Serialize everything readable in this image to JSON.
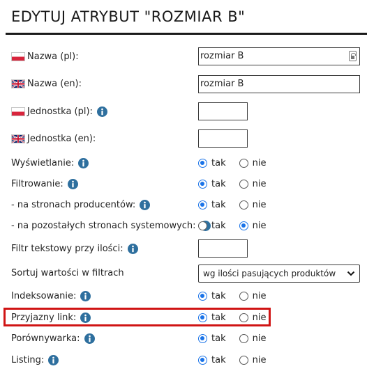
{
  "dialog": {
    "title": "EDYTUJ ATRYBUT \"ROZMIAR B\""
  },
  "fields": {
    "name_pl": {
      "label": "Nazwa (pl):",
      "value": "rozmiar B"
    },
    "name_en": {
      "label": "Nazwa (en):",
      "value": "rozmiar B"
    },
    "unit_pl": {
      "label": "Jednostka (pl):",
      "value": ""
    },
    "unit_en": {
      "label": "Jednostka (en):",
      "value": ""
    },
    "display": {
      "label": "Wyświetlanie:",
      "selected": "tak"
    },
    "filtering": {
      "label": "Filtrowanie:",
      "selected": "tak"
    },
    "producer_pages": {
      "label": "- na stronach producentów:",
      "selected": "tak"
    },
    "system_pages": {
      "label": "- na pozostałych stronach systemowych:",
      "selected": "nie"
    },
    "text_filter_qty": {
      "label": "Filtr tekstowy przy ilości:",
      "value": ""
    },
    "sort_values": {
      "label": "Sortuj wartości w filtrach",
      "selected": "wg ilości pasujących produktów"
    },
    "indexing": {
      "label": "Indeksowanie:",
      "selected": "tak"
    },
    "friendly_link": {
      "label": "Przyjazny link:",
      "selected": "tak"
    },
    "comparator": {
      "label": "Porównywarka:",
      "selected": "tak"
    },
    "listing": {
      "label": "Listing:",
      "selected": "tak"
    }
  },
  "options": {
    "yes": "tak",
    "no": "nie"
  },
  "colors": {
    "accent": "#1a73e8",
    "highlight": "#d01414",
    "flag_pl_red": "#d8243c",
    "info_icon": "#2e6f9e"
  },
  "icons": {
    "flag_pl": "poland-flag-icon",
    "flag_en": "uk-flag-icon",
    "info": "info-icon",
    "keyboard": "keyboard-icon",
    "chevron": "chevron-down-icon"
  }
}
